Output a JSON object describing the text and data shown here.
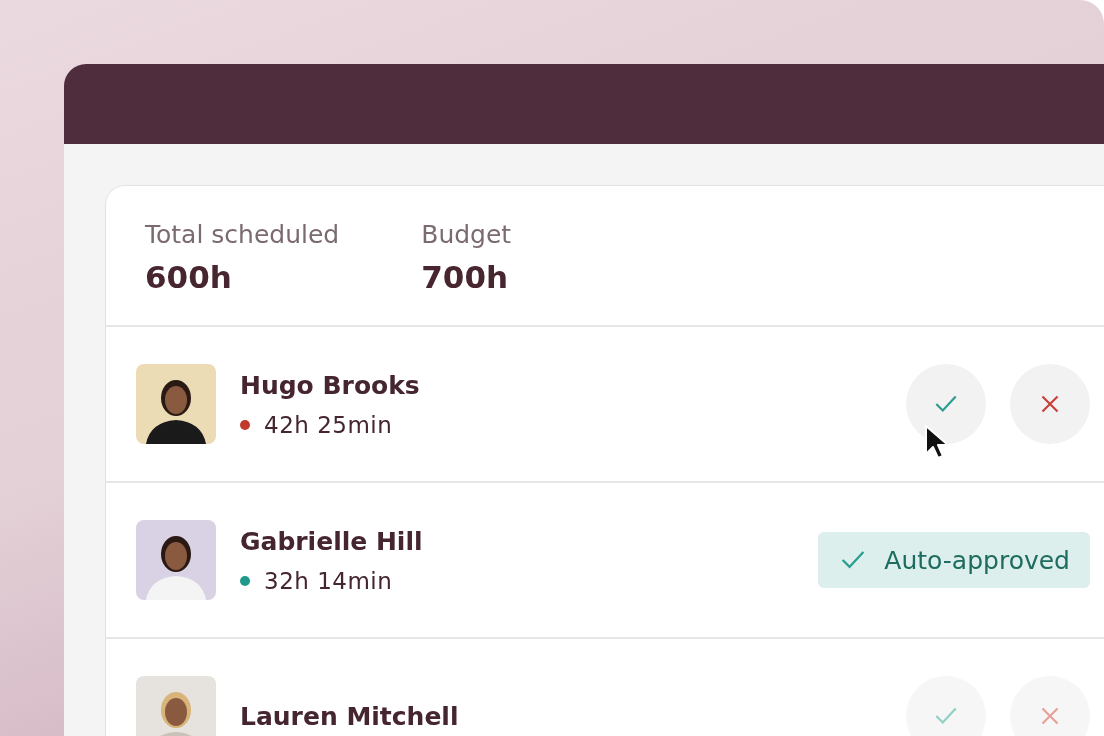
{
  "stats": [
    {
      "label": "Total scheduled",
      "value": "600h"
    },
    {
      "label": "Budget",
      "value": "700h"
    }
  ],
  "rows": [
    {
      "name": "Hugo Brooks",
      "time": "42h 25min",
      "color": "#c0392b",
      "kind": "pending"
    },
    {
      "name": "Gabrielle Hill",
      "time": "32h 14min",
      "color": "#1f9a8a",
      "kind": "approved",
      "badge": "Auto-approved"
    },
    {
      "name": "Lauren Mitchell",
      "kind": "pending"
    }
  ]
}
